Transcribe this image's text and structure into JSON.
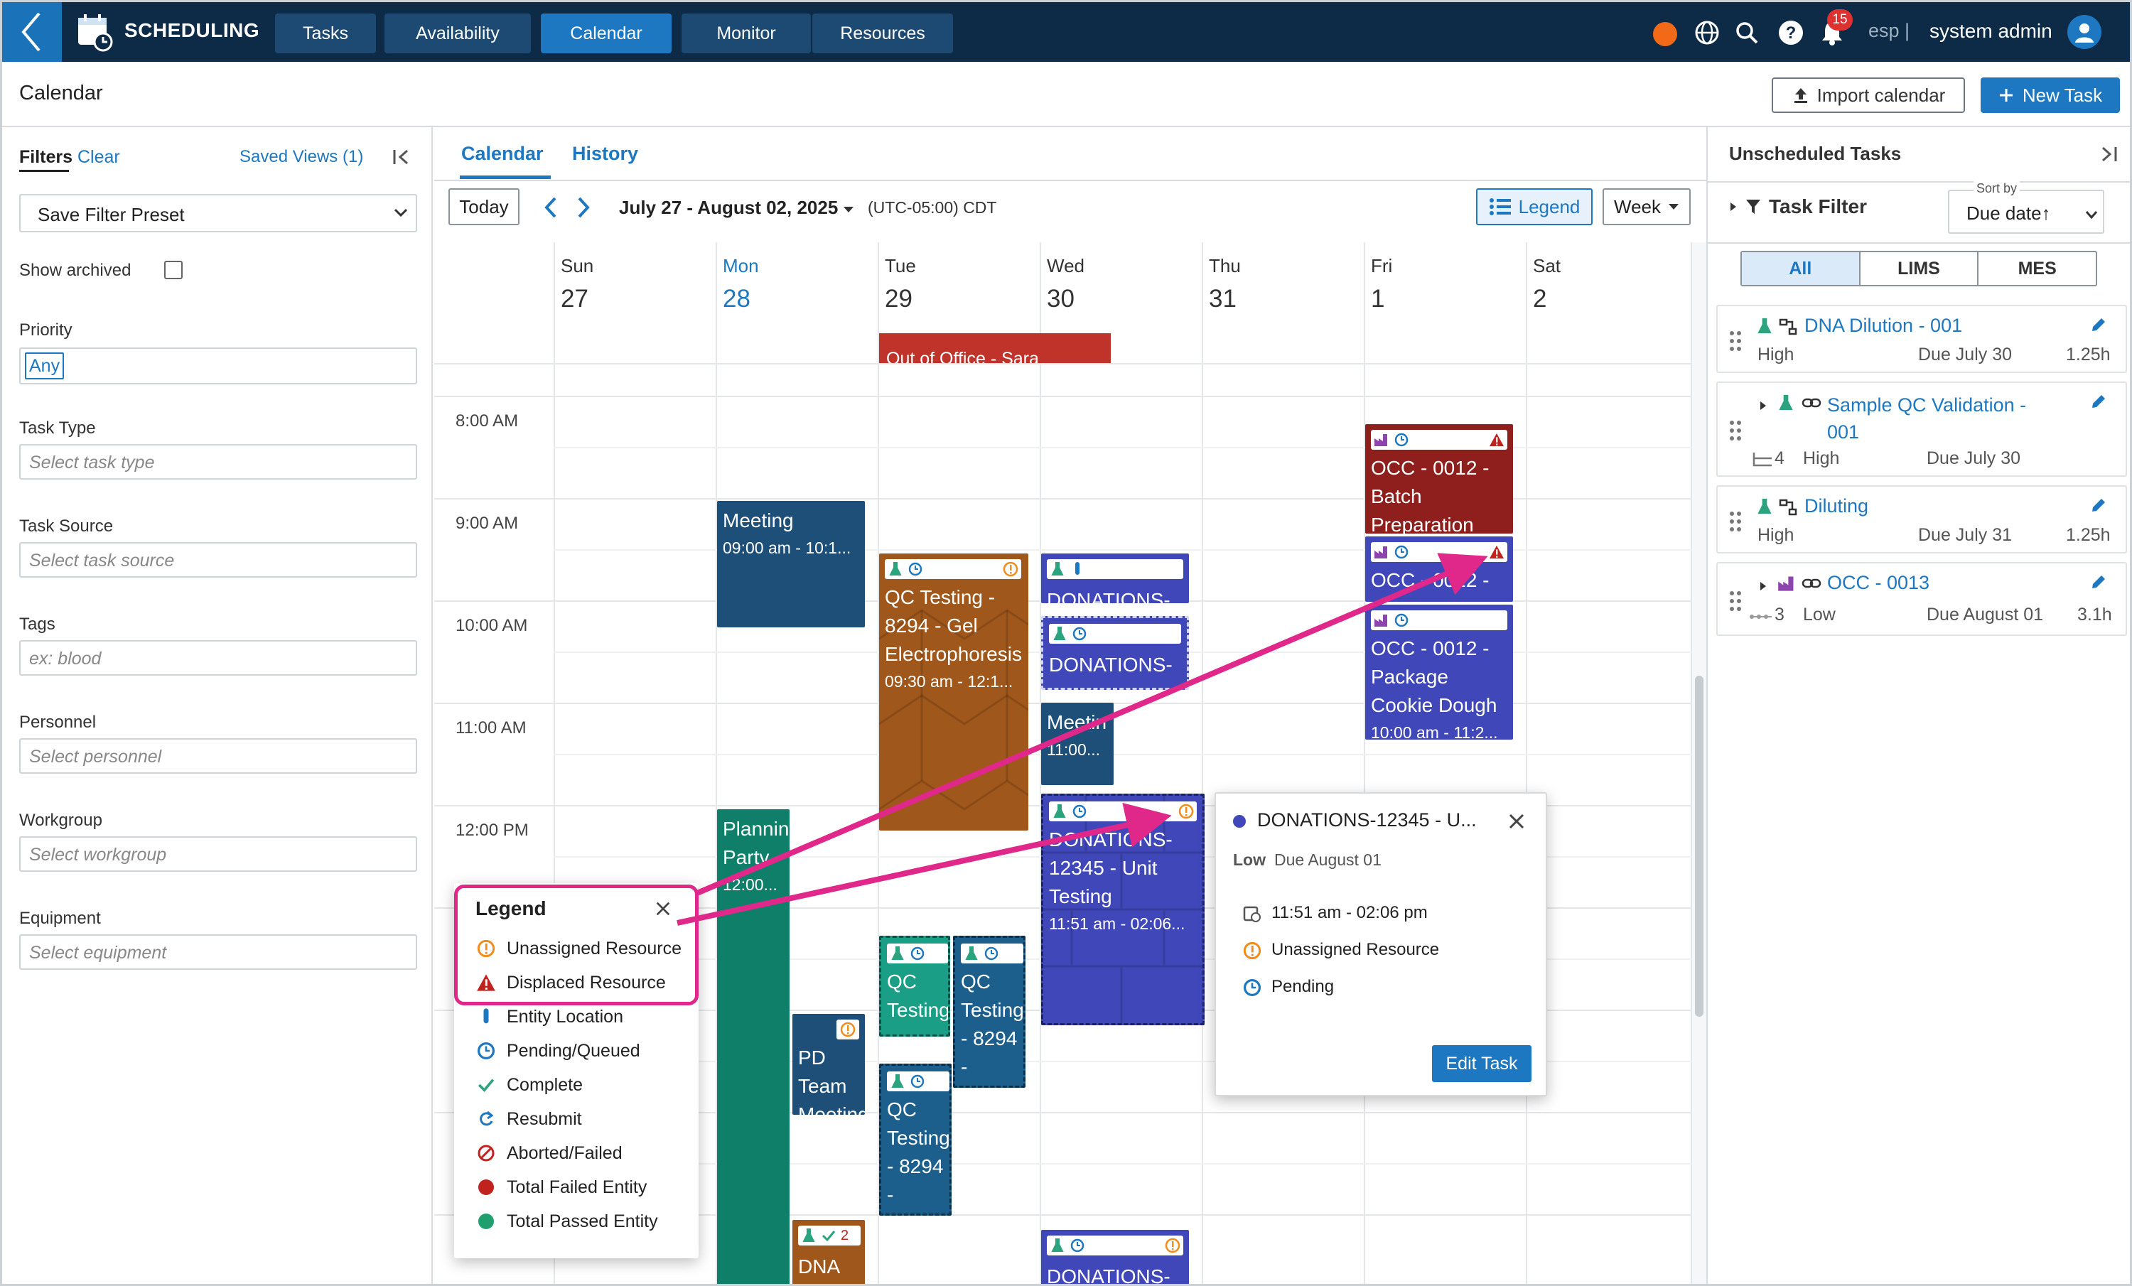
{
  "nav": {
    "app_name": "SCHEDULING",
    "tabs": [
      "Tasks",
      "Availability",
      "Calendar",
      "Monitor",
      "Resources"
    ],
    "active_tab": "Calendar",
    "notification_count": "15",
    "language": "esp |",
    "user": "system admin"
  },
  "header": {
    "title": "Calendar",
    "import_label": "Import calendar",
    "new_task_label": "New Task"
  },
  "filters": {
    "title": "Filters",
    "clear": "Clear",
    "saved_views": "Saved Views (1)",
    "preset": "Save Filter Preset",
    "show_archived": "Show archived",
    "priority_label": "Priority",
    "priority_value": "Any",
    "task_type_label": "Task Type",
    "task_type_placeholder": "Select task type",
    "task_source_label": "Task Source",
    "task_source_placeholder": "Select task source",
    "tags_label": "Tags",
    "tags_placeholder": "ex: blood",
    "personnel_label": "Personnel",
    "personnel_placeholder": "Select personnel",
    "workgroup_label": "Workgroup",
    "workgroup_placeholder": "Select workgroup",
    "equipment_label": "Equipment",
    "equipment_placeholder": "Select equipment"
  },
  "calendar": {
    "tabs": [
      "Calendar",
      "History"
    ],
    "today": "Today",
    "range": "July 27 - August 02, 2025",
    "timezone": "(UTC-05:00) CDT",
    "legend_btn": "Legend",
    "view": "Week",
    "days": [
      {
        "name": "Sun",
        "num": "27"
      },
      {
        "name": "Mon",
        "num": "28"
      },
      {
        "name": "Tue",
        "num": "29"
      },
      {
        "name": "Wed",
        "num": "30"
      },
      {
        "name": "Thu",
        "num": "31"
      },
      {
        "name": "Fri",
        "num": "1"
      },
      {
        "name": "Sat",
        "num": "2"
      }
    ],
    "times": [
      "8:00 AM",
      "9:00 AM",
      "10:00 AM",
      "11:00 AM",
      "12:00 PM"
    ],
    "allday_event": "Out of Office - Sara",
    "events": {
      "meeting_mon": {
        "title": "Meeting",
        "time": "09:00 am - 10:1..."
      },
      "qc_tue": {
        "title": "QC Testing - 8294 - Gel Electrophoresis",
        "time": "09:30 am - 12:1..."
      },
      "donations_wed1": {
        "title": "DONATIONS-"
      },
      "donations_wed2": {
        "title": "DONATIONS-"
      },
      "meeting_wed": {
        "title": "Meetin",
        "time": "11:00..."
      },
      "donations_main": {
        "title": "DONATIONS-12345 - Unit Testing",
        "time": "11:51 am - 02:06..."
      },
      "donations_wed3": {
        "title": "DONATIONS-"
      },
      "occ_fri1": {
        "title": "OCC - 0012 - Batch Preparation"
      },
      "occ_fri2": {
        "title": "OCC - 0012 -"
      },
      "occ_fri3": {
        "title": "OCC - 0012 - Package Cookie Dough",
        "time": "10:00 am - 11:2..."
      },
      "planning_mon": {
        "title": "Planning Party",
        "time": "12:00..."
      },
      "pd_team": {
        "title": "PD Team Meeting"
      },
      "dna_mon": {
        "title": "DNA",
        "count": "2"
      },
      "qc_small1": {
        "title": "QC Testing"
      },
      "qc_small2": {
        "title": "QC Testing - 8294 -"
      },
      "qc_small3": {
        "title": "QC Testing - 8294 -"
      }
    }
  },
  "popover": {
    "title": "DONATIONS-12345 - U...",
    "priority": "Low",
    "due": "Due August 01",
    "time": "11:51 am - 02:06 pm",
    "resource": "Unassigned Resource",
    "status": "Pending",
    "edit": "Edit Task"
  },
  "legend": {
    "title": "Legend",
    "items": [
      "Unassigned Resource",
      "Displaced Resource",
      "Entity Location",
      "Pending/Queued",
      "Complete",
      "Resubmit",
      "Aborted/Failed",
      "Total Failed Entity",
      "Total Passed Entity"
    ]
  },
  "unscheduled": {
    "title": "Unscheduled Tasks",
    "task_filter": "Task Filter",
    "sort_label": "Sort by",
    "sort_value": "Due date↑",
    "segments": [
      "All",
      "LIMS",
      "MES"
    ],
    "cards": [
      {
        "name": "DNA Dilution - 001",
        "priority": "High",
        "due": "Due July 30",
        "duration": "1.25h"
      },
      {
        "name": "Sample QC Validation - 001",
        "subcount": "4",
        "priority": "High",
        "due": "Due July 30"
      },
      {
        "name": "Diluting",
        "priority": "High",
        "due": "Due July 31",
        "duration": "1.25h"
      },
      {
        "name": "OCC - 0013",
        "subcount": "3",
        "priority": "Low",
        "due": "Due August 01",
        "duration": "3.1h"
      }
    ]
  },
  "colors": {
    "nav_bg": "#0d2b46",
    "accent": "#1d78c1",
    "highlight": "#e0278a",
    "teal": "#0f7f6a",
    "navy": "#1d4f78",
    "indigo": "#4047b8",
    "brown": "#a0571b",
    "maroon": "#8e1f1c"
  }
}
